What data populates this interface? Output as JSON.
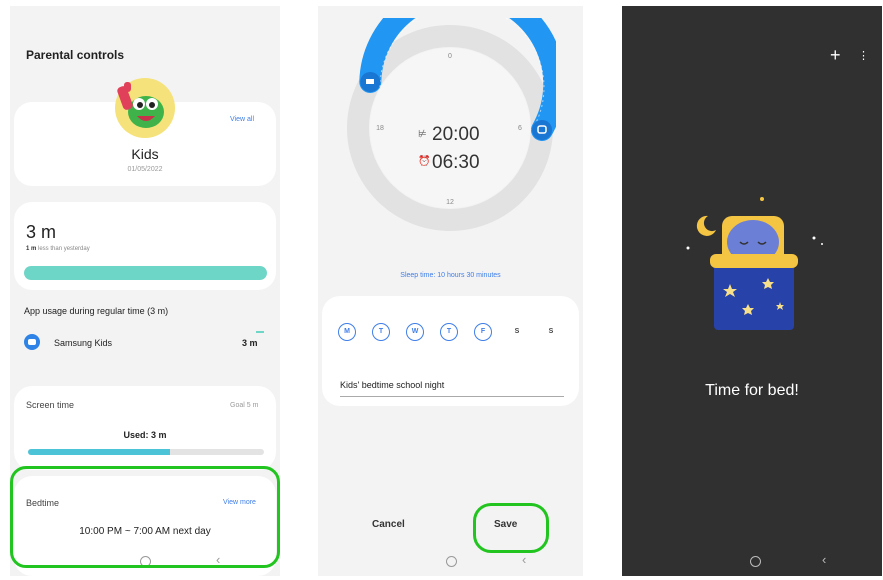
{
  "screen1": {
    "title": "Parental controls",
    "profile": {
      "name": "Kids",
      "date": "01/05/2022",
      "view_all": "View all"
    },
    "usage": {
      "value": "3 m",
      "delta_bold": "1 m",
      "delta_rest": " less than yesterday",
      "bar_fraction": 1.0,
      "section_title": "App usage during regular time (3 m)",
      "app_name": "Samsung Kids",
      "app_time": "3 m"
    },
    "screen_time": {
      "label": "Screen time",
      "goal": "Goal 5 m",
      "used": "Used: 3 m",
      "used_fraction": 0.6
    },
    "bedtime": {
      "label": "Bedtime",
      "view_more": "View more",
      "range": "10:00 PM ~ 7:00 AM next day"
    }
  },
  "screen2": {
    "dial": {
      "top_label": "0",
      "right_label": "6",
      "bottom_label": "12",
      "left_label": "18"
    },
    "bed_time": "20:00",
    "wake_time": "06:30",
    "sleep_time": "Sleep time: 10 hours 30 minutes",
    "days": [
      {
        "label": "M",
        "selected": true
      },
      {
        "label": "T",
        "selected": true
      },
      {
        "label": "W",
        "selected": true
      },
      {
        "label": "T",
        "selected": true
      },
      {
        "label": "F",
        "selected": true
      },
      {
        "label": "S",
        "selected": false
      },
      {
        "label": "S",
        "selected": false
      }
    ],
    "name_value": "Kids' bedtime school night",
    "cancel": "Cancel",
    "save": "Save"
  },
  "screen3": {
    "plus": "+",
    "menu": "⋮",
    "message": "Time for bed!"
  },
  "colors": {
    "accent_blue": "#2196f3",
    "teal": "#6dd6c6",
    "highlight_green": "#22c51f",
    "dark_bg": "#303030"
  }
}
